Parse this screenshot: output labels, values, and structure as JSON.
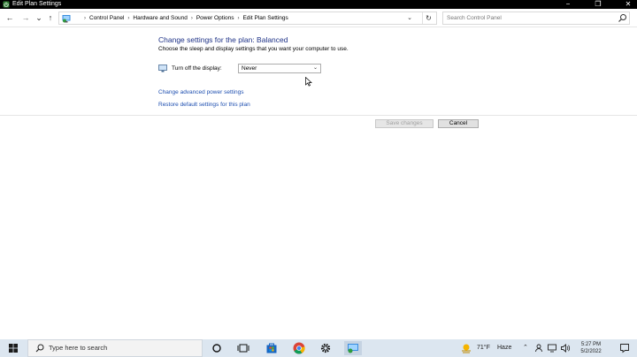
{
  "window": {
    "title": "Edit Plan Settings",
    "controls": {
      "minimize": "−",
      "maximize": "❐",
      "close": "✕"
    }
  },
  "nav": {
    "back": "←",
    "forward": "→",
    "recent": "⌄",
    "up": "↑",
    "breadcrumbs": [
      "Control Panel",
      "Hardware and Sound",
      "Power Options",
      "Edit Plan Settings"
    ],
    "separator": "›",
    "dropdown": "⌄",
    "refresh": "↻",
    "search_placeholder": "Search Control Panel"
  },
  "content": {
    "heading": "Change settings for the plan: Balanced",
    "subtext": "Choose the sleep and display settings that you want your computer to use.",
    "display_label": "Turn off the display:",
    "display_value": "Never",
    "link_advanced": "Change advanced power settings",
    "link_restore": "Restore default settings for this plan",
    "save_button": "Save changes",
    "cancel_button": "Cancel"
  },
  "taskbar": {
    "search_placeholder": "Type here to search",
    "weather_temp": "71°F",
    "weather_cond": "Haze",
    "time": "5:27 PM",
    "date": "5/2/2022"
  },
  "colors": {
    "heading": "#1e3287",
    "link": "#1e4fb0",
    "taskbar": "#dce6f0",
    "titlebar": "#000000"
  }
}
